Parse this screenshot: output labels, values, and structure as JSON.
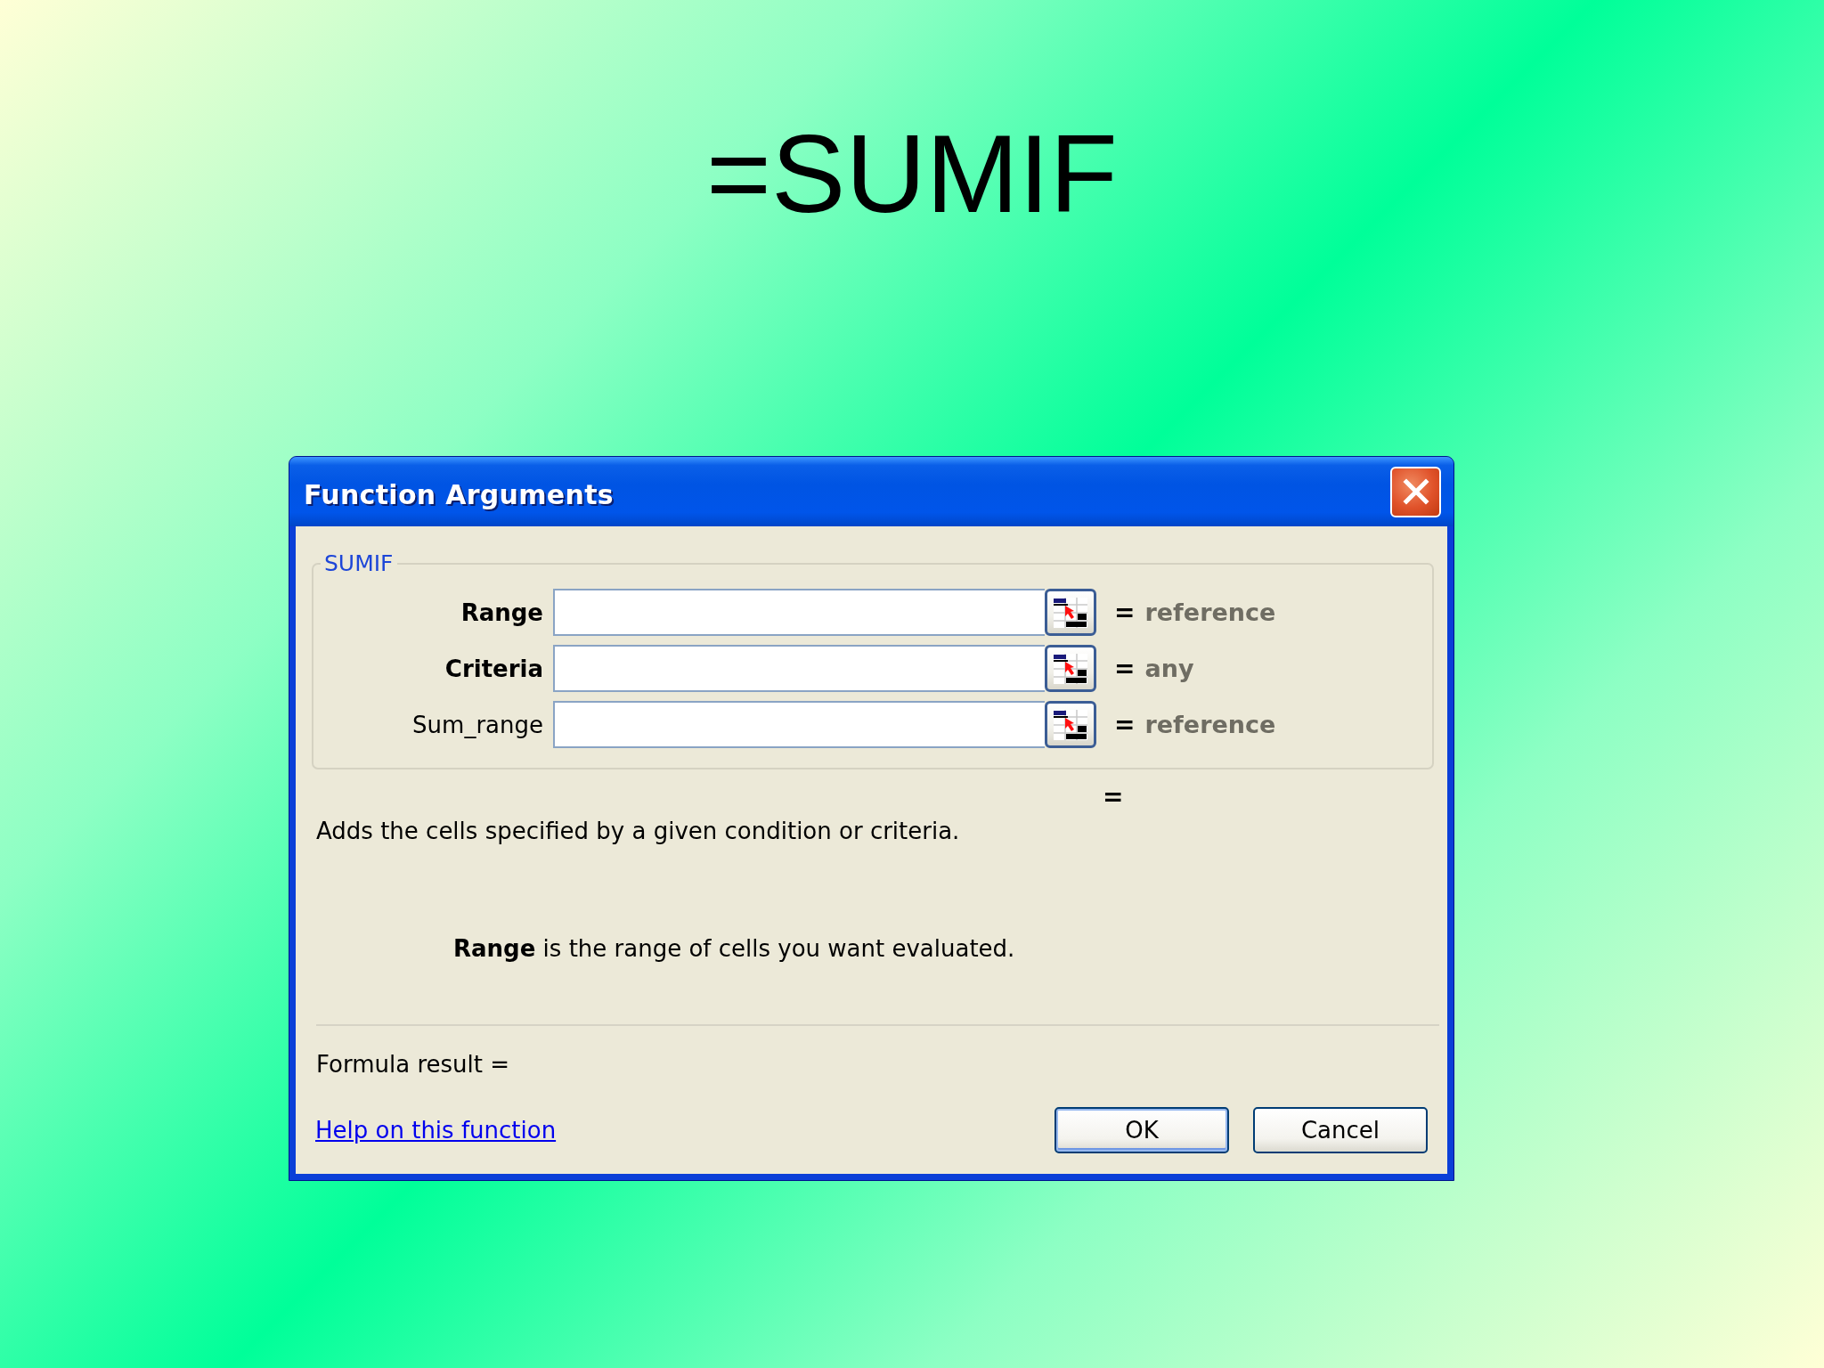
{
  "slide_title": "=SUMIF",
  "dialog": {
    "title": "Function Arguments",
    "function_group": {
      "legend": "SUMIF",
      "arguments": [
        {
          "label": "Range",
          "required": true,
          "equals": "=",
          "result": "reference"
        },
        {
          "label": "Criteria",
          "required": true,
          "equals": "=",
          "result": "any"
        },
        {
          "label": "Sum_range",
          "required": false,
          "equals": "=",
          "result": "reference"
        }
      ]
    },
    "formula_equals": "=",
    "description": "Adds the cells specified by a given condition or criteria.",
    "argument_help": "**Range** is the range of cells you want evaluated.",
    "formula_result": "Formula result =",
    "help_link": "Help on this function",
    "buttons": [
      {
        "label": "OK",
        "kind": "default"
      },
      {
        "label": "Cancel",
        "kind": "normal"
      }
    ]
  }
}
